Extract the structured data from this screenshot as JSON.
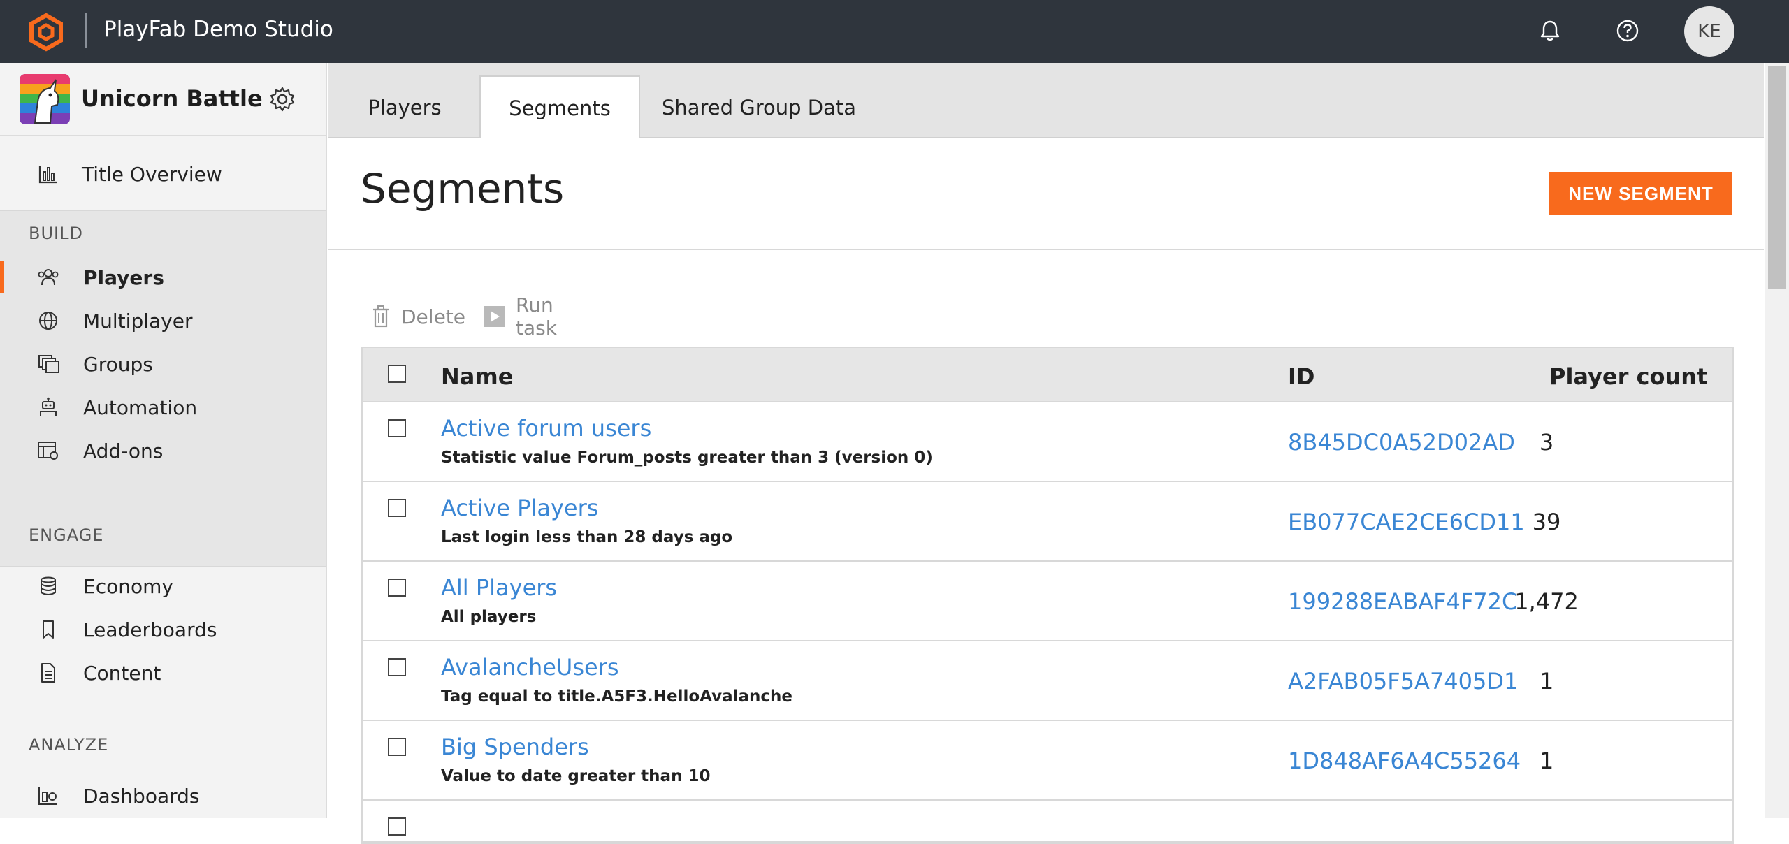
{
  "topbar": {
    "studio_name": "PlayFab Demo Studio",
    "avatar_initials": "KE",
    "icons": [
      "playfab-logo-icon",
      "bell-icon",
      "help-icon"
    ],
    "accent_color": "#f86a1d"
  },
  "sidebar": {
    "title_name": "Unicorn Battle",
    "title_overview": "Title Overview",
    "sections": [
      {
        "label": "BUILD",
        "items": [
          {
            "label": "Players",
            "icon": "players-icon",
            "active": true
          },
          {
            "label": "Multiplayer",
            "icon": "globe-icon"
          },
          {
            "label": "Groups",
            "icon": "groups-icon"
          },
          {
            "label": "Automation",
            "icon": "robot-icon"
          },
          {
            "label": "Add-ons",
            "icon": "addons-icon"
          }
        ]
      },
      {
        "label": "ENGAGE",
        "items": [
          {
            "label": "Economy",
            "icon": "coins-icon"
          },
          {
            "label": "Leaderboards",
            "icon": "bookmark-icon"
          },
          {
            "label": "Content",
            "icon": "document-icon"
          }
        ]
      },
      {
        "label": "ANALYZE",
        "items": [
          {
            "label": "Dashboards",
            "icon": "dashboard-icon"
          }
        ]
      }
    ]
  },
  "tabs": [
    {
      "label": "Players"
    },
    {
      "label": "Segments",
      "active": true
    },
    {
      "label": "Shared Group Data"
    }
  ],
  "main": {
    "page_title": "Segments",
    "new_segment_label": "NEW SEGMENT",
    "toolbar": {
      "delete_label": "Delete",
      "run_task_label": "Run task"
    },
    "table": {
      "headers": {
        "name": "Name",
        "id": "ID",
        "count": "Player count"
      },
      "rows": [
        {
          "name": "Active forum users",
          "description": "Statistic value Forum_posts greater than 3 (version 0)",
          "id": "8B45DC0A52D02AD",
          "count": "3"
        },
        {
          "name": "Active Players",
          "description": "Last login less than 28 days ago",
          "id": "EB077CAE2CE6CD11",
          "count": "39"
        },
        {
          "name": "All Players",
          "description": "All players",
          "id": "199288EABAF4F72C",
          "count": "1,472"
        },
        {
          "name": "AvalancheUsers",
          "description": "Tag equal to title.A5F3.HelloAvalanche",
          "id": "A2FAB05F5A7405D1",
          "count": "1"
        },
        {
          "name": "Big Spenders",
          "description": "Value to date greater than 10",
          "id": "1D848AF6A4C55264",
          "count": "1"
        }
      ]
    }
  }
}
